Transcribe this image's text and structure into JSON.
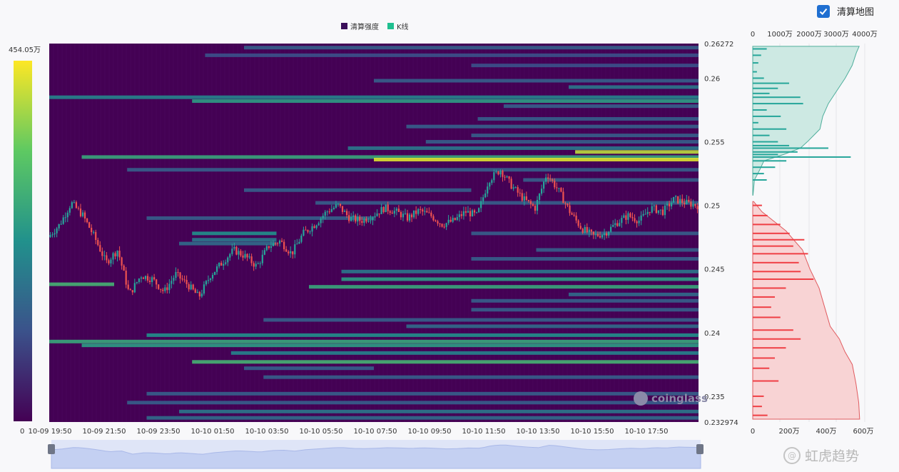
{
  "toggle": {
    "label": "清算地图",
    "checked": true
  },
  "legend": [
    {
      "label": "清算强度",
      "color": "#3b0f5a"
    },
    {
      "label": "K线",
      "color": "#1fbf8f"
    }
  ],
  "colorbar": {
    "max_label": "454.05万",
    "min_label": "0"
  },
  "brand": "coinglass",
  "watermark": "虹虎趋势",
  "colors": {
    "heat_bg": "#440154",
    "up": "#26a69a",
    "down": "#ef5350",
    "short_fill": "#cde9e3",
    "long_fill": "#f8d3d4"
  },
  "chart_data": {
    "type": "heatmap",
    "x_ticks": [
      "10-09 19:50",
      "10-09 21:50",
      "10-09 23:50",
      "10-10 01:50",
      "10-10 03:50",
      "10-10 05:50",
      "10-10 07:50",
      "10-10 09:50",
      "10-10 11:50",
      "10-10 13:50",
      "10-10 15:50",
      "10-10 17:50"
    ],
    "y_range": [
      0.232974,
      0.26272
    ],
    "y_ticks": [
      "0.26272",
      "0.26",
      "0.255",
      "0.25",
      "0.245",
      "0.24",
      "0.235",
      "0.232974"
    ],
    "y_tick_values": [
      0.26272,
      0.26,
      0.255,
      0.25,
      0.245,
      0.24,
      0.235,
      0.232974
    ],
    "x_span_hours": 24,
    "price_path": [
      [
        0,
        0.2475
      ],
      [
        0.5,
        0.2485
      ],
      [
        1,
        0.2502
      ],
      [
        1.5,
        0.2492
      ],
      [
        2,
        0.2475
      ],
      [
        2.5,
        0.2455
      ],
      [
        3,
        0.2465
      ],
      [
        3.5,
        0.243
      ],
      [
        4,
        0.2445
      ],
      [
        4.5,
        0.2442
      ],
      [
        5,
        0.2432
      ],
      [
        5.5,
        0.2446
      ],
      [
        6,
        0.2438
      ],
      [
        6.5,
        0.2428
      ],
      [
        7,
        0.2445
      ],
      [
        7.5,
        0.2455
      ],
      [
        8,
        0.2465
      ],
      [
        8.5,
        0.246
      ],
      [
        9,
        0.2452
      ],
      [
        9.5,
        0.2468
      ],
      [
        10,
        0.2472
      ],
      [
        10.5,
        0.2462
      ],
      [
        11,
        0.2478
      ],
      [
        11.5,
        0.2485
      ],
      [
        12,
        0.2495
      ],
      [
        12.5,
        0.25
      ],
      [
        13,
        0.249
      ],
      [
        13.5,
        0.2488
      ],
      [
        14,
        0.2492
      ],
      [
        14.5,
        0.2498
      ],
      [
        15,
        0.2495
      ],
      [
        15.5,
        0.249
      ],
      [
        16,
        0.2496
      ],
      [
        16.5,
        0.2492
      ],
      [
        17,
        0.2485
      ],
      [
        17.5,
        0.2488
      ],
      [
        18,
        0.2495
      ],
      [
        18.5,
        0.2492
      ],
      [
        19,
        0.252
      ],
      [
        19.5,
        0.2528
      ],
      [
        20,
        0.2515
      ],
      [
        20.5,
        0.2505
      ],
      [
        21,
        0.2498
      ],
      [
        21.5,
        0.2525
      ],
      [
        22,
        0.2512
      ],
      [
        22.5,
        0.2495
      ],
      [
        23,
        0.2482
      ],
      [
        23.5,
        0.2476
      ],
      [
        24,
        0.2478
      ],
      [
        24.5,
        0.2486
      ],
      [
        25,
        0.2492
      ],
      [
        25.5,
        0.2488
      ],
      [
        26,
        0.2498
      ],
      [
        26.5,
        0.2495
      ],
      [
        27,
        0.2505
      ],
      [
        27.5,
        0.2502
      ],
      [
        28,
        0.25
      ]
    ],
    "bands": [
      [
        0.2624,
        0.3,
        1,
        0.3
      ],
      [
        0.2618,
        0.24,
        1,
        0.25
      ],
      [
        0.261,
        0.65,
        1,
        0.25
      ],
      [
        0.2598,
        0.5,
        1,
        0.3
      ],
      [
        0.2593,
        0.8,
        1,
        0.4
      ],
      [
        0.2585,
        0.0,
        1,
        0.45
      ],
      [
        0.2582,
        0.22,
        1,
        0.55
      ],
      [
        0.2578,
        0.7,
        1,
        0.3
      ],
      [
        0.2568,
        0.66,
        1,
        0.3
      ],
      [
        0.2562,
        0.55,
        1,
        0.3
      ],
      [
        0.2555,
        0.65,
        1,
        0.3
      ],
      [
        0.255,
        0.58,
        1,
        0.3
      ],
      [
        0.2545,
        0.46,
        1,
        0.4
      ],
      [
        0.2542,
        0.81,
        1,
        0.9
      ],
      [
        0.2538,
        0.05,
        1,
        0.6
      ],
      [
        0.2536,
        0.5,
        1,
        0.95
      ],
      [
        0.2528,
        0.12,
        1,
        0.3
      ],
      [
        0.252,
        0.73,
        1,
        0.3
      ],
      [
        0.2512,
        0.3,
        0.65,
        0.3
      ],
      [
        0.2502,
        0.41,
        1,
        0.3
      ],
      [
        0.249,
        0.15,
        0.5,
        0.3
      ],
      [
        0.2478,
        0.22,
        0.35,
        0.5
      ],
      [
        0.2473,
        0.22,
        0.35,
        0.4
      ],
      [
        0.2478,
        0.65,
        1,
        0.3
      ],
      [
        0.247,
        0.2,
        0.35,
        0.35
      ],
      [
        0.2465,
        0.75,
        1,
        0.3
      ],
      [
        0.2458,
        0.65,
        1,
        0.3
      ],
      [
        0.2448,
        0.45,
        1,
        0.4
      ],
      [
        0.2442,
        0.45,
        1,
        0.55
      ],
      [
        0.2438,
        0.0,
        0.1,
        0.65
      ],
      [
        0.2436,
        0.4,
        1,
        0.6
      ],
      [
        0.243,
        0.8,
        1,
        0.35
      ],
      [
        0.2425,
        0.65,
        1,
        0.3
      ],
      [
        0.2418,
        0.65,
        1,
        0.3
      ],
      [
        0.241,
        0.33,
        1,
        0.3
      ],
      [
        0.2405,
        0.55,
        1,
        0.35
      ],
      [
        0.2398,
        0.15,
        1,
        0.5
      ],
      [
        0.2393,
        0.0,
        1,
        0.6
      ],
      [
        0.239,
        0.05,
        1,
        0.55
      ],
      [
        0.2384,
        0.28,
        1,
        0.45
      ],
      [
        0.2377,
        0.22,
        1,
        0.65
      ],
      [
        0.2372,
        0.3,
        0.5,
        0.3
      ],
      [
        0.2365,
        0.33,
        1,
        0.3
      ],
      [
        0.2352,
        0.15,
        1,
        0.3
      ],
      [
        0.2345,
        0.12,
        1,
        0.3
      ],
      [
        0.2338,
        0.2,
        1,
        0.4
      ],
      [
        0.2333,
        0.15,
        1,
        0.35
      ]
    ],
    "side_top_ticks": [
      "0",
      "1000万",
      "2000万",
      "3000万",
      "4000万"
    ],
    "side_top_max": 4000,
    "side_bottom_ticks": [
      "0",
      "200万",
      "400万",
      "600万"
    ],
    "side_bottom_max": 600,
    "short_cumulative": [
      [
        0.2625,
        3800
      ],
      [
        0.262,
        3700
      ],
      [
        0.261,
        3550
      ],
      [
        0.26,
        3300
      ],
      [
        0.259,
        3000
      ],
      [
        0.258,
        2700
      ],
      [
        0.257,
        2500
      ],
      [
        0.256,
        2400
      ],
      [
        0.255,
        1950
      ],
      [
        0.2545,
        1700
      ],
      [
        0.254,
        1100
      ],
      [
        0.2535,
        400
      ],
      [
        0.2528,
        250
      ],
      [
        0.252,
        60
      ],
      [
        0.2508,
        10
      ]
    ],
    "long_cumulative": [
      [
        0.2503,
        5
      ],
      [
        0.2495,
        50
      ],
      [
        0.248,
        180
      ],
      [
        0.2465,
        270
      ],
      [
        0.245,
        310
      ],
      [
        0.2435,
        360
      ],
      [
        0.242,
        390
      ],
      [
        0.2405,
        420
      ],
      [
        0.2395,
        470
      ],
      [
        0.2385,
        500
      ],
      [
        0.2375,
        540
      ],
      [
        0.236,
        560
      ],
      [
        0.2345,
        575
      ],
      [
        0.2332,
        580
      ]
    ],
    "short_bars": [
      [
        0.2623,
        500
      ],
      [
        0.2618,
        300
      ],
      [
        0.2612,
        200
      ],
      [
        0.2605,
        150
      ],
      [
        0.26,
        400
      ],
      [
        0.2596,
        1300
      ],
      [
        0.2592,
        900
      ],
      [
        0.2588,
        600
      ],
      [
        0.2585,
        1700
      ],
      [
        0.258,
        1800
      ],
      [
        0.2575,
        500
      ],
      [
        0.257,
        1000
      ],
      [
        0.2565,
        200
      ],
      [
        0.256,
        1200
      ],
      [
        0.2555,
        600
      ],
      [
        0.255,
        900
      ],
      [
        0.2547,
        1300
      ],
      [
        0.2545,
        2700
      ],
      [
        0.2542,
        1600
      ],
      [
        0.254,
        900
      ],
      [
        0.2538,
        3500
      ],
      [
        0.2535,
        1200
      ],
      [
        0.253,
        800
      ],
      [
        0.2525,
        400
      ],
      [
        0.252,
        500
      ]
    ],
    "long_bars": [
      [
        0.25,
        50
      ],
      [
        0.2492,
        80
      ],
      [
        0.2485,
        150
      ],
      [
        0.2478,
        200
      ],
      [
        0.2473,
        280
      ],
      [
        0.2468,
        220
      ],
      [
        0.2462,
        300
      ],
      [
        0.2455,
        250
      ],
      [
        0.2448,
        260
      ],
      [
        0.2442,
        330
      ],
      [
        0.2435,
        180
      ],
      [
        0.2428,
        120
      ],
      [
        0.242,
        100
      ],
      [
        0.2412,
        150
      ],
      [
        0.2402,
        220
      ],
      [
        0.2395,
        260
      ],
      [
        0.2388,
        180
      ],
      [
        0.238,
        120
      ],
      [
        0.2372,
        90
      ],
      [
        0.2362,
        140
      ],
      [
        0.235,
        60
      ],
      [
        0.2342,
        50
      ],
      [
        0.2335,
        80
      ]
    ]
  }
}
